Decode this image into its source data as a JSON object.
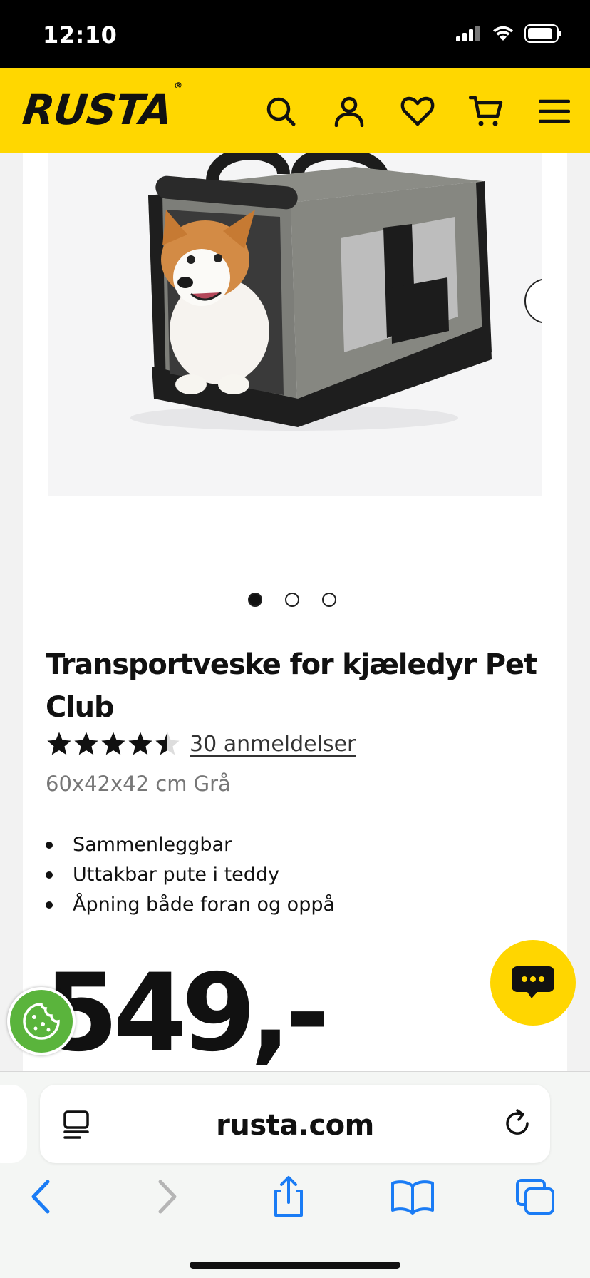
{
  "status_bar": {
    "time": "12:10"
  },
  "header": {
    "logo": "RUSTA",
    "logo_mark": "®",
    "icons": [
      "search-icon",
      "user-icon",
      "heart-icon",
      "cart-icon",
      "menu-icon"
    ]
  },
  "gallery": {
    "image_alt": "Dog in grey pet carrier",
    "slide_count": 3,
    "active_slide": 1
  },
  "product": {
    "title": "Transportveske for kjæledyr Pet Club",
    "rating": 4.5,
    "max_rating": 5,
    "reviews_label": "30 anmeldelser",
    "variant": "60x42x42 cm Grå",
    "features": [
      "Sammenleggbar",
      "Uttakbar pute i teddy",
      "Åpning både foran og oppå"
    ],
    "price": "549,-"
  },
  "browser": {
    "url": "rusta.com"
  },
  "colors": {
    "brand_yellow": "#ffd700",
    "cookie_green": "#5ab43c",
    "safari_blue": "#1a7cf5"
  }
}
